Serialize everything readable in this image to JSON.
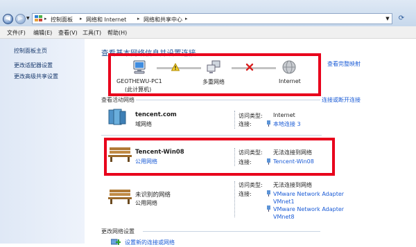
{
  "address_bar": {
    "crumbs": [
      "控制面板",
      "网络和 Internet",
      "网络和共享中心"
    ]
  },
  "menu": {
    "items": [
      "文件(F)",
      "编辑(E)",
      "查看(V)",
      "工具(T)",
      "帮助(H)"
    ]
  },
  "left_pane": {
    "items": [
      "控制面板主页",
      "更改适配器设置",
      "更改高级共享设置"
    ]
  },
  "main": {
    "title": "查看基本网络信息并设置连接",
    "view_full_map": "查看完整映射",
    "map": {
      "computer_name": "GEOTHEWU-PC1",
      "computer_sub": "(此计算机)",
      "middle_label": "多重网络",
      "internet_label": "Internet"
    },
    "active_networks_heading": "查看活动网络",
    "connect_disconnect": "连接或断开连接",
    "access_type_label": "访问类型:",
    "connection_label": "连接:",
    "networks": [
      {
        "name": "tencent.com",
        "category": "域网络",
        "access_type": "Internet",
        "connections": [
          "本地连接 3"
        ],
        "icon": "domain-network-icon"
      },
      {
        "name": "Tencent-Win08",
        "category": "公用网络",
        "access_type": "无法连接到网络",
        "connections": [
          "Tencent-Win08"
        ],
        "icon": "public-network-bench-icon"
      },
      {
        "name": "未识别的网络",
        "category": "公用网络",
        "access_type": "无法连接到网络",
        "connections": [
          "VMware Network Adapter VMnet1",
          "VMware Network Adapter VMnet8"
        ],
        "icon": "public-network-bench-icon"
      }
    ],
    "change_settings_heading": "更改网络设置",
    "change_settings_first": "设置新的连接或网络"
  },
  "colors": {
    "highlight_box": "#e8001b",
    "link": "#1a5bd6",
    "title": "#1d4f91"
  }
}
